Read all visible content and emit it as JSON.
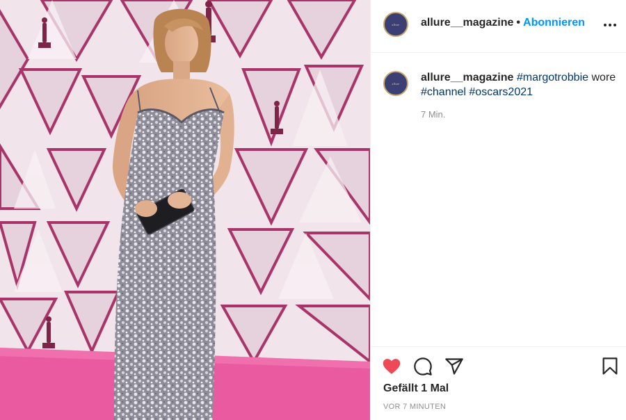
{
  "post": {
    "photo": {
      "subject": "margot-robbie-oscars-2021-red-carpet",
      "colors": {
        "carpet": "#ee5fa4",
        "backdrop": "#f0e3ea",
        "frame": "#a8346a",
        "dress": "#9a98a4",
        "statuette": "#8a2a4e"
      }
    },
    "header": {
      "avatar_brand": "allure",
      "username": "allure__magazine",
      "separator": "•",
      "follow_label": "Abonnieren",
      "more_icon": "more-horizontal-icon"
    },
    "caption": {
      "avatar_brand": "allure",
      "username": "allure__magazine",
      "hashtags": [
        "#margotrobbie",
        "#channel",
        "#oscars2021"
      ],
      "middle_word": "wore",
      "time": "7 Min."
    },
    "actions": {
      "like_icon": "heart-filled-icon",
      "comment_icon": "comment-icon",
      "share_icon": "share-paper-plane-icon",
      "save_icon": "bookmark-icon",
      "like_color": "#ed4956",
      "likes_text": "Gefällt 1 Mal",
      "date_text": "VOR 7 MINUTEN"
    },
    "accent_color": "#0095f6",
    "hashtag_color": "#00376b"
  }
}
